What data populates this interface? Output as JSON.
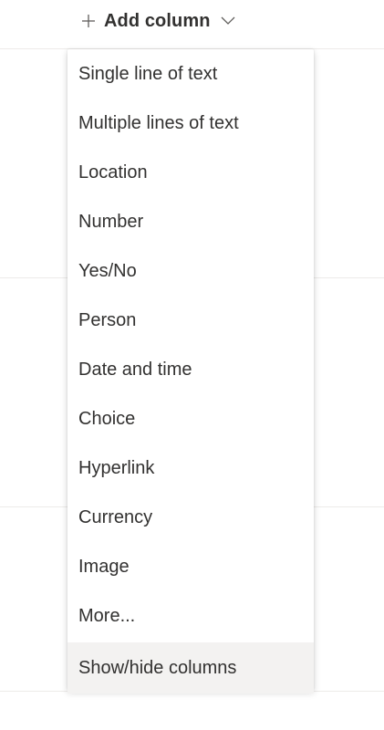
{
  "header": {
    "add_column_label": "Add column",
    "plus_icon": "plus-icon",
    "chevron_icon": "chevron-down-icon"
  },
  "menu": {
    "items": [
      {
        "label": "Single line of text"
      },
      {
        "label": "Multiple lines of text"
      },
      {
        "label": "Location"
      },
      {
        "label": "Number"
      },
      {
        "label": "Yes/No"
      },
      {
        "label": "Person"
      },
      {
        "label": "Date and time"
      },
      {
        "label": "Choice"
      },
      {
        "label": "Hyperlink"
      },
      {
        "label": "Currency"
      },
      {
        "label": "Image"
      },
      {
        "label": "More..."
      }
    ],
    "show_hide_label": "Show/hide columns"
  },
  "colors": {
    "text": "#323130",
    "divider": "#edebe9",
    "hover_bg": "#f3f2f1"
  }
}
